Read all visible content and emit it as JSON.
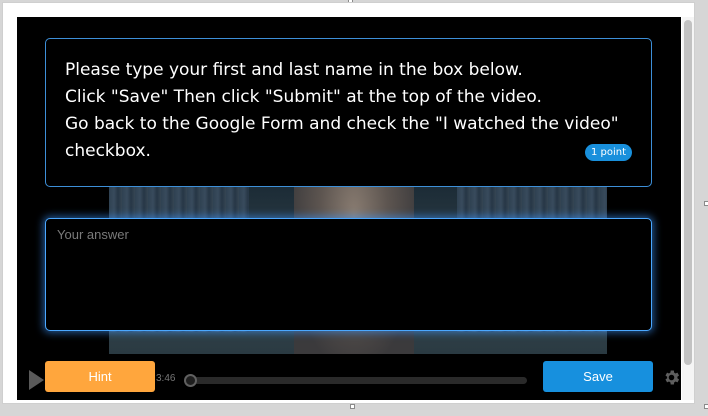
{
  "question": {
    "text": "Please type your first and last name in the box below.\nClick \"Save\" Then click \"Submit\" at the top of the video.\nGo back to the Google Form and check the \"I watched the video\"\ncheckbox.",
    "points": "1 point"
  },
  "answer": {
    "placeholder": "Your answer",
    "value": ""
  },
  "controls": {
    "hint_label": "Hint",
    "save_label": "Save",
    "time": "3:46",
    "progress_fraction": 0
  },
  "icons": {
    "play": "play-icon",
    "settings": "gear-icon"
  },
  "colors": {
    "hint_button": "#ffa63d",
    "save_button": "#1790de",
    "points_badge": "#1990dc",
    "input_glow": "#4ba8ff"
  }
}
